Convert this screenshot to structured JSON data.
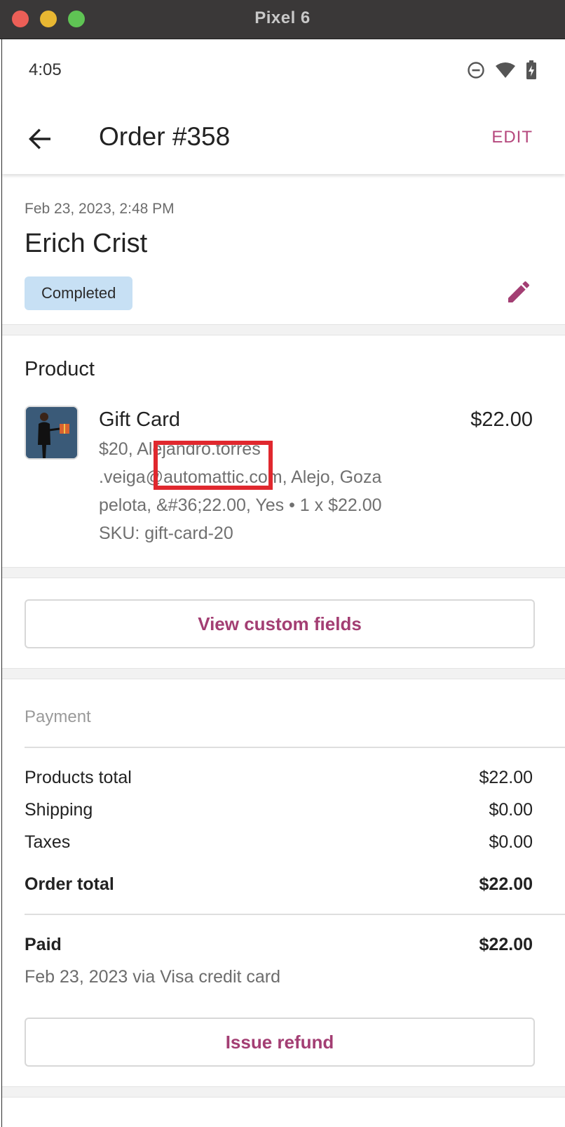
{
  "window": {
    "title": "Pixel 6"
  },
  "statusbar": {
    "time": "4:05"
  },
  "appbar": {
    "title": "Order #358",
    "edit_label": "EDIT"
  },
  "order": {
    "date": "Feb 23, 2023, 2:48 PM",
    "customer": "Erich Crist",
    "status": "Completed"
  },
  "product_section": {
    "title": "Product",
    "item": {
      "name": "Gift Card",
      "price": "$22.00",
      "meta_line1": "$20, Alejandro.torres",
      "meta_line2": ".veiga@automattic.com, Alejo, Goza",
      "meta_line3": "pelota, &#36;22.00, Yes • 1 x $22.00",
      "sku": "SKU: gift-card-20"
    }
  },
  "custom_fields": {
    "label": "View custom fields"
  },
  "payment": {
    "title": "Payment",
    "rows": [
      {
        "label": "Products total",
        "value": "$22.00"
      },
      {
        "label": "Shipping",
        "value": "$0.00"
      },
      {
        "label": "Taxes",
        "value": "$0.00"
      }
    ],
    "order_total": {
      "label": "Order total",
      "value": "$22.00"
    },
    "paid": {
      "label": "Paid",
      "value": "$22.00",
      "note": "Feb 23, 2023 via Visa credit card"
    },
    "refund_label": "Issue refund"
  },
  "colors": {
    "accent": "#b5487d",
    "badge": "#c7e0f4",
    "highlight": "#e0282e"
  }
}
